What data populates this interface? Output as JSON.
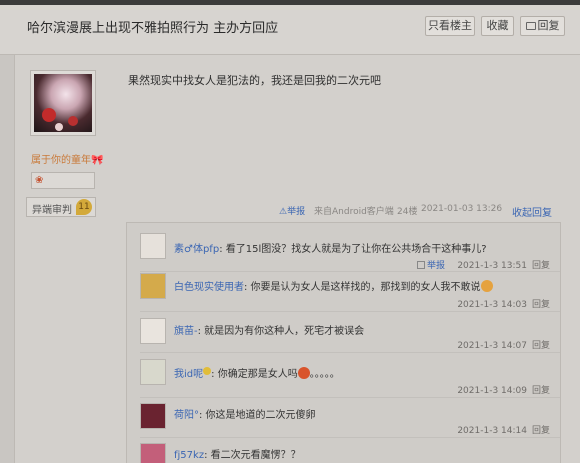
{
  "header": {
    "title": "哈尔滨漫展上出现不雅拍照行为 主办方回应",
    "only_lz": "只看楼主",
    "favorite": "收藏",
    "reply": "回复"
  },
  "author": {
    "name": "属于你的童年",
    "level_label": "异端审判",
    "level": "11"
  },
  "post": {
    "content": "果然现实中找女人是犯法的，我还是回我的二次元吧",
    "report": "举报",
    "client": "来自Android客户端",
    "floor": "24楼",
    "time": "2021-01-03 13:26",
    "fold": "收起回复"
  },
  "replies": [
    {
      "name": "素♂体pfp",
      "text": ": 看了15l图没？找女人就是为了让你在公共场合干这种事儿?",
      "report": "举报",
      "time": "2021-1-3 13:51",
      "reply": "回复"
    },
    {
      "name": "白色现实使用者",
      "text": ": 你要是认为女人是这样找的，那找到的女人我不敢说",
      "time": "2021-1-3 14:03",
      "reply": "回复"
    },
    {
      "name": "旗苗-",
      "text": ": 就是因为有你这种人，死宅才被误会",
      "time": "2021-1-3 14:07",
      "reply": "回复"
    },
    {
      "name": "我id呢",
      "text": ": 你确定那是女人吗",
      "text_tail": "。。。。。",
      "time": "2021-1-3 14:09",
      "reply": "回复"
    },
    {
      "name": "荷阳°",
      "text": ": 你这是地道的二次元傻卵",
      "time": "2021-1-3 14:14",
      "reply": "回复"
    },
    {
      "name": "fj57kz",
      "text": ": 看二次元看魔愣？？"
    }
  ]
}
